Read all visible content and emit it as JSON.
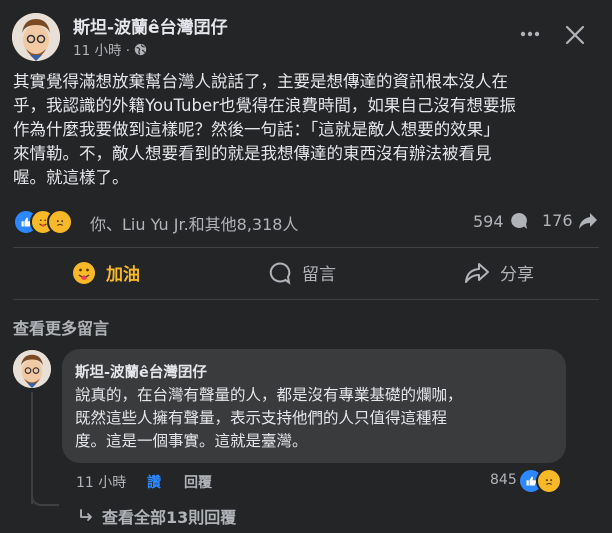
{
  "post": {
    "author": "斯坦-波蘭ê台灣囝仔",
    "time": "11 小時 ·",
    "body": "其實覺得滿想放棄幫台灣人說話了，主要是想傳達的資訊根本沒人在\n乎，我認識的外籍YouTuber也覺得在浪費時間，如果自己沒有想要振\n作為什麼我要做到這樣呢？然後一句話：「這就是敵人想要的效果」\n來情勒。不，敵人想要看到的就是我想傳達的東西沒有辦法被看見\n喔。就這樣了。",
    "reactions_text": "你、Liu Yu Jr.和其他8,318人",
    "comment_count": "594",
    "share_count": "176"
  },
  "actions": {
    "like_label": "加油",
    "comment_label": "留言",
    "share_label": "分享"
  },
  "view_more_comments": "查看更多留言",
  "comment": {
    "author": "斯坦-波蘭ê台灣囝仔",
    "body": "說真的，在台灣有聲量的人，都是沒有專業基礎的爛咖，\n既然這些人擁有聲量，表示支持他們的人只值得這種程\n度。這是一個事實。這就是臺灣。",
    "time": "11 小時",
    "like_label": "讚",
    "reply_label": "回覆",
    "reaction_count": "845"
  },
  "view_all_replies": "查看全部13則回覆",
  "colors": {
    "background": "#242526",
    "bubble": "#3a3b3c",
    "like_blue": "#2d88ff",
    "haha_yellow": "#f7b928",
    "care_heart": "#f33e58"
  }
}
